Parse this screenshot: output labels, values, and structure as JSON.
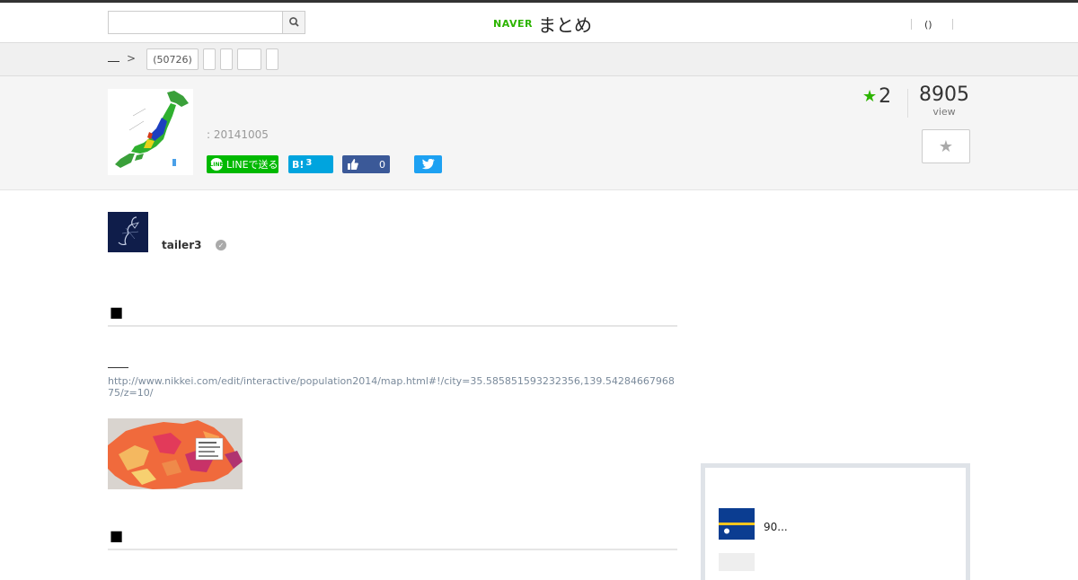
{
  "header": {
    "logo_brand": "NAVER",
    "logo_title": "まとめ",
    "search_placeholder": "",
    "nav_paren": "()"
  },
  "breadcrumb": {
    "tags": [
      "(50726)",
      "",
      "",
      "",
      ""
    ]
  },
  "article": {
    "date": ": 20141005",
    "favorites": "2",
    "views": "8905",
    "views_label": "view",
    "share": {
      "line_label": "LINEで送る",
      "hatena_label": "B!",
      "hatena_count": "3",
      "facebook_count": "0"
    },
    "author": "tailer3",
    "headings": [
      "■",
      "■"
    ],
    "link_url": "http://www.nikkei.com/edit/interactive/population2014/map.html#!/city=35.585851593232356,139.5428466796875/z=10/"
  },
  "sidebar": {
    "item_title": "90..."
  },
  "colors": {
    "brand_green": "#2db400",
    "line_green": "#00b900",
    "hatena_blue": "#00a4de",
    "facebook_blue": "#3b5998",
    "twitter_blue": "#1da1f2"
  }
}
